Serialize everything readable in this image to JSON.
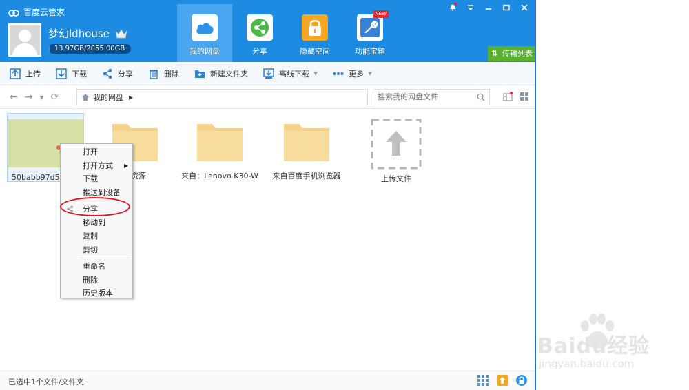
{
  "app": {
    "title": "百度云管家"
  },
  "user": {
    "name": "梦幻ldhouse",
    "quota_text": "13.97GB/2055.00GB",
    "quota_fraction": 0.0068
  },
  "nav": [
    {
      "label": "我的网盘",
      "icon": "cloud-icon"
    },
    {
      "label": "分享",
      "icon": "share-icon"
    },
    {
      "label": "隐藏空间",
      "icon": "lock-icon"
    },
    {
      "label": "功能宝箱",
      "icon": "wrench-icon",
      "badge": "NEW"
    }
  ],
  "window_controls": [
    "bell",
    "dropdown",
    "minimize",
    "maximize",
    "close"
  ],
  "transfer": {
    "label": "传输列表"
  },
  "toolbar": {
    "upload": "上传",
    "download": "下载",
    "share": "分享",
    "delete": "删除",
    "new_folder": "新建文件夹",
    "offline_download": "离线下载",
    "more": "更多"
  },
  "address": {
    "crumb": "我的网盘"
  },
  "search": {
    "placeholder": "搜索我的网盘文件"
  },
  "files": [
    {
      "name": "50babb97d5c",
      "type": "image"
    },
    {
      "name": "资源",
      "type": "folder"
    },
    {
      "name": "来自：Lenovo K30-W",
      "type": "folder"
    },
    {
      "name": "来自百度手机浏览器",
      "type": "folder"
    },
    {
      "name": "上传文件",
      "type": "upload"
    }
  ],
  "context_menu": {
    "group1": [
      "打开",
      "打开方式",
      "下载",
      "推送到设备"
    ],
    "group2": [
      "分享",
      "移动到",
      "复制",
      "剪切"
    ],
    "group3": [
      "重命名",
      "删除",
      "历史版本"
    ],
    "highlighted": "分享"
  },
  "status": {
    "text": "已选中1个文件/文件夹"
  },
  "watermark": {
    "brand": "Baidu经验",
    "url": "jingyan.baidu.com"
  },
  "colors": {
    "header": "#1e8be3",
    "active_nav": "#4aa6f0",
    "transfer": "#58b02f",
    "folder": "#f5d28c",
    "ring": "#e0141e"
  }
}
